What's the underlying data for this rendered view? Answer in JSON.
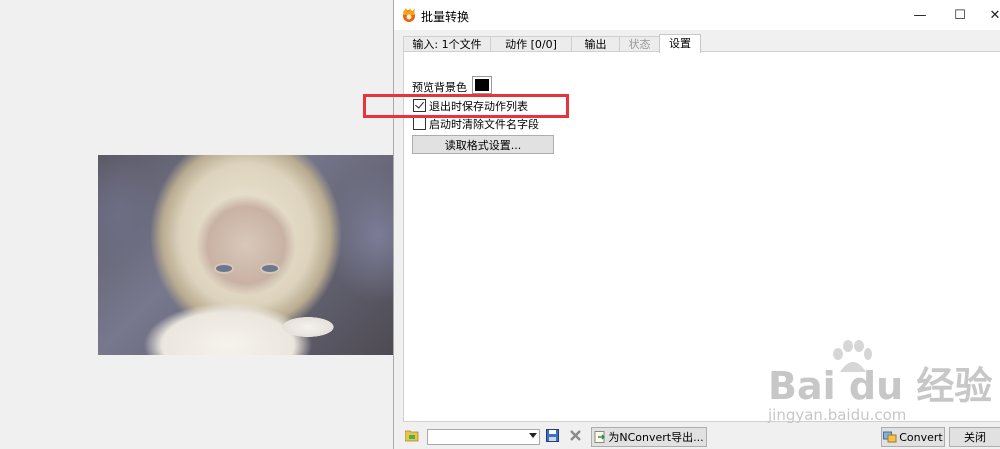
{
  "window": {
    "title": "批量转换",
    "controls": {
      "minimize": "—",
      "maximize": "☐",
      "close": "✕"
    }
  },
  "tabs": [
    {
      "label": "输入: 1个文件",
      "state": "normal"
    },
    {
      "label": "动作 [0/0]",
      "state": "normal"
    },
    {
      "label": "输出",
      "state": "normal"
    },
    {
      "label": "状态",
      "state": "disabled"
    },
    {
      "label": "设置",
      "state": "active"
    }
  ],
  "settings": {
    "preview_bg_label": "预览背景色",
    "preview_bg_color": "#000000",
    "save_actions_label": "退出时保存动作列表",
    "save_actions_checked": true,
    "clear_filename_label": "启动时清除文件名字段",
    "clear_filename_checked": false,
    "read_format_button": "读取格式设置..."
  },
  "bottom_bar": {
    "combo_value": "",
    "export_button": "为NConvert导出...",
    "convert_button": "Convert",
    "close_button": "关闭"
  },
  "icons": {
    "app": "xnview-icon",
    "open": "folder-open-icon",
    "save": "floppy-disk-icon",
    "delete": "delete-x-icon",
    "export": "script-export-icon",
    "convert": "convert-images-icon"
  },
  "watermark": {
    "main": "Bai du 经验",
    "sub": "jingyan.baidu.com"
  },
  "accent_colors": {
    "highlight_box": "#e8333a"
  }
}
